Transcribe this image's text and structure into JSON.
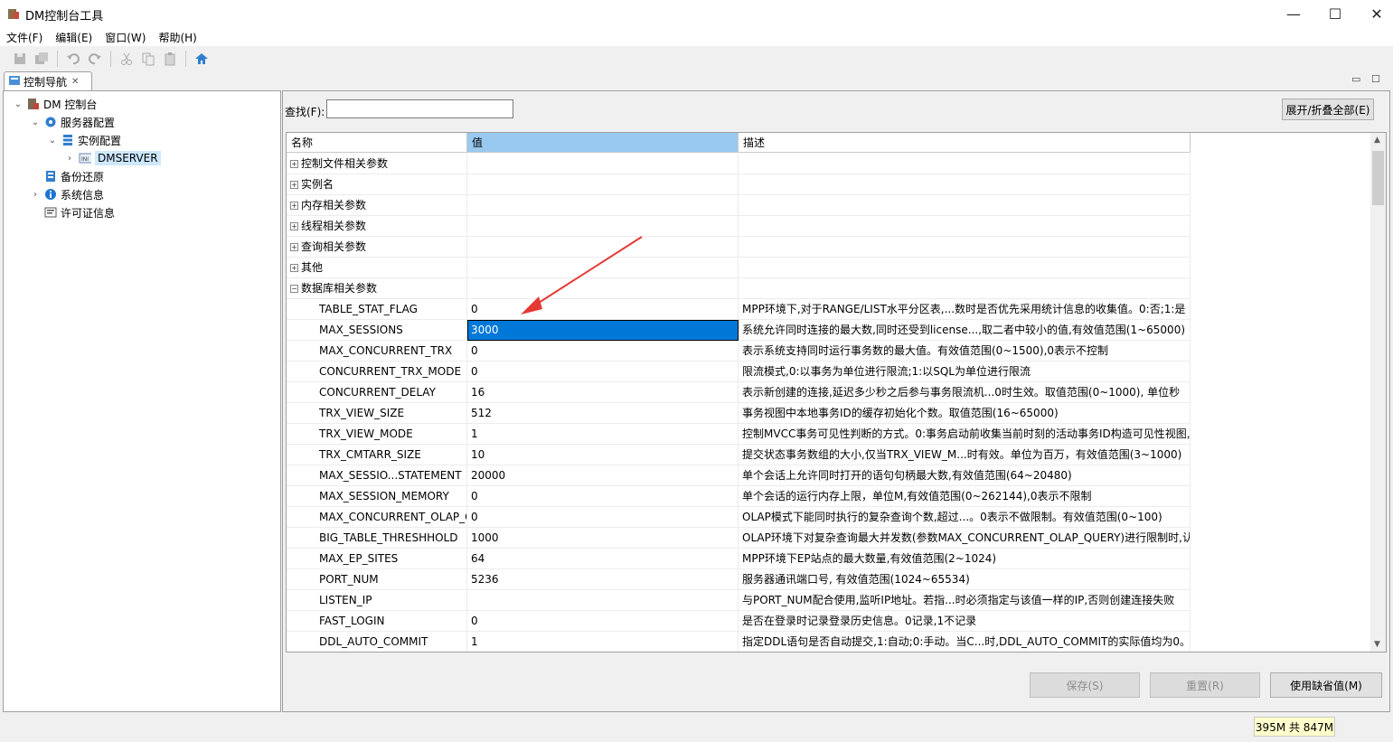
{
  "window": {
    "title": "DM控制台工具",
    "min": "—",
    "max": "☐",
    "close": "✕"
  },
  "menu": [
    "文件(F)",
    "编辑(E)",
    "窗口(W)",
    "帮助(H)"
  ],
  "nav": {
    "tab_label": "控制导航",
    "tab_close": "✕",
    "tree": [
      {
        "label": "DM 控制台",
        "icon": "server-rack-icon",
        "twisty": "⌄"
      },
      {
        "label": "服务器配置",
        "icon": "gear-icon",
        "twisty": "⌄"
      },
      {
        "label": "实例配置",
        "icon": "list-icon",
        "twisty": "⌄"
      },
      {
        "label": "DMSERVER",
        "icon": "ini-file-icon",
        "twisty": "›"
      },
      {
        "label": "备份还原",
        "icon": "backup-icon",
        "twisty": ""
      },
      {
        "label": "系统信息",
        "icon": "info-icon",
        "twisty": "›"
      },
      {
        "label": "许可证信息",
        "icon": "license-icon",
        "twisty": ""
      }
    ]
  },
  "find": {
    "label": "查找(F):",
    "value": ""
  },
  "expand_all_label": "展开/折叠全部(E)",
  "grid": {
    "columns": [
      "名称",
      "值",
      "描述"
    ],
    "groups": [
      "控制文件相关参数",
      "实例名",
      "内存相关参数",
      "线程相关参数",
      "查询相关参数",
      "其他",
      "数据库相关参数"
    ],
    "expanded_group": "数据库相关参数",
    "rows": [
      {
        "name": "TABLE_STAT_FLAG",
        "value": "0",
        "desc": "MPP环境下,对于RANGE/LIST水平分区表,...数时是否优先采用统计信息的收集值。0:否;1:是"
      },
      {
        "name": "MAX_SESSIONS",
        "value": "3000",
        "desc": "系统允许同时连接的最大数,同时还受到license...,取二者中较小的值,有效值范围(1~65000)"
      },
      {
        "name": "MAX_CONCURRENT_TRX",
        "value": "0",
        "desc": "表示系统支持同时运行事务数的最大值。有效值范围(0~1500),0表示不控制"
      },
      {
        "name": "CONCURRENT_TRX_MODE",
        "value": "0",
        "desc": "限流模式,0:以事务为单位进行限流;1:以SQL为单位进行限流"
      },
      {
        "name": "CONCURRENT_DELAY",
        "value": "16",
        "desc": "表示新创建的连接,延迟多少秒之后参与事务限流机...0时生效。取值范围(0~1000), 单位秒"
      },
      {
        "name": "TRX_VIEW_SIZE",
        "value": "512",
        "desc": "事务视图中本地事务ID的缓存初始化个数。取值范围(16~65000)"
      },
      {
        "name": "TRX_VIEW_MODE",
        "value": "1",
        "desc": "控制MVCC事务可见性判断的方式。0:事务启动前收集当前时刻的活动事务ID构造可见性视图,"
      },
      {
        "name": "TRX_CMTARR_SIZE",
        "value": "10",
        "desc": "提交状态事务数组的大小,仅当TRX_VIEW_M...时有效。单位为百万，有效值范围(3~1000)"
      },
      {
        "name": "MAX_SESSIO...STATEMENT",
        "value": "20000",
        "desc": "单个会话上允许同时打开的语句句柄最大数,有效值范围(64~20480)"
      },
      {
        "name": "MAX_SESSION_MEMORY",
        "value": "0",
        "desc": "单个会话的运行内存上限，单位M,有效值范围(0~262144),0表示不限制"
      },
      {
        "name": "MAX_CONCURRENT_OLAP_QUERY",
        "value": "0",
        "desc": "OLAP模式下能同时执行的复杂查询个数,超过...。0表示不做限制。有效值范围(0~100)"
      },
      {
        "name": "BIG_TABLE_THRESHHOLD",
        "value": "1000",
        "desc": "OLAP环境下对复杂查询最大并发数(参数MAX_CONCURRENT_OLAP_QUERY)进行限制时,认"
      },
      {
        "name": "MAX_EP_SITES",
        "value": "64",
        "desc": "MPP环境下EP站点的最大数量,有效值范围(2~1024)"
      },
      {
        "name": "PORT_NUM",
        "value": "5236",
        "desc": "服务器通讯端口号, 有效值范围(1024~65534)"
      },
      {
        "name": "LISTEN_IP",
        "value": "",
        "desc": "与PORT_NUM配合使用,监听IP地址。若指...时必须指定与该值一样的IP,否则创建连接失败"
      },
      {
        "name": "FAST_LOGIN",
        "value": "0",
        "desc": "是否在登录时记录登录历史信息。0记录,1不记录"
      },
      {
        "name": "DDL_AUTO_COMMIT",
        "value": "1",
        "desc": "指定DDL语句是否自动提交,1:自动;0:手动。当C...时,DDL_AUTO_COMMIT的实际值均为0。"
      }
    ],
    "selected_row": "MAX_SESSIONS"
  },
  "buttons": {
    "save": "保存(S)",
    "reset": "重置(R)",
    "defaults": "使用缺省值(M)"
  },
  "status": {
    "memory": "395M 共 847M"
  },
  "colors": {
    "selection": "#0078d7",
    "header_active": "#99c9ef",
    "tree_selected": "#cde8ff",
    "annotation_arrow": "#e53935"
  }
}
